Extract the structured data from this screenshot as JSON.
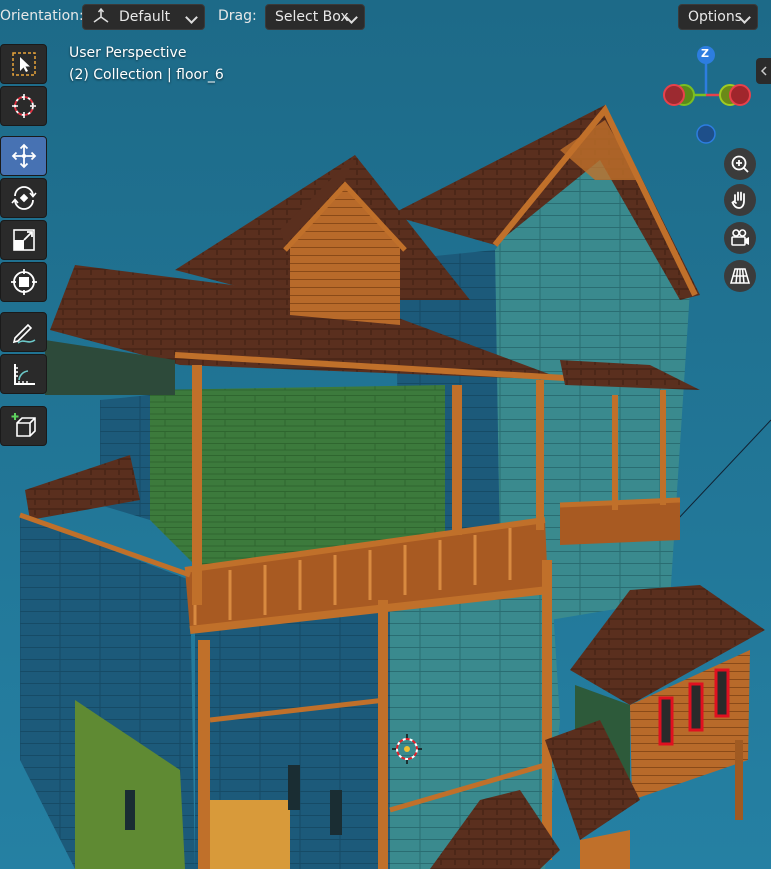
{
  "header": {
    "orientation_label": "Orientation:",
    "orientation_value": "Default",
    "drag_label": "Drag:",
    "drag_value": "Select Box",
    "options_label": "Options"
  },
  "overlay": {
    "view_name": "User Perspective",
    "collection_info": "(2) Collection | floor_6"
  },
  "toolbar": {
    "tools": [
      {
        "icon": "select-box-icon",
        "active": false
      },
      {
        "icon": "cursor-icon",
        "active": false
      },
      {
        "icon": "move-icon",
        "active": true
      },
      {
        "icon": "rotate-icon",
        "active": false
      },
      {
        "icon": "scale-icon",
        "active": false
      },
      {
        "icon": "transform-icon",
        "active": false
      },
      {
        "icon": "annotate-icon",
        "active": false
      },
      {
        "icon": "measure-icon",
        "active": false
      },
      {
        "icon": "add-cube-icon",
        "active": false
      }
    ]
  },
  "gizmo": {
    "z_label": "Z",
    "colors": {
      "x": "#e8414b",
      "y": "#7bbf22",
      "z": "#2d7de0"
    }
  },
  "navigation": [
    "zoom-icon",
    "hand-icon",
    "camera-icon",
    "grid-icon"
  ],
  "colors": {
    "background": "#1f6e8c",
    "active_tool": "#4772b3",
    "panel": "#2b2b2b"
  }
}
